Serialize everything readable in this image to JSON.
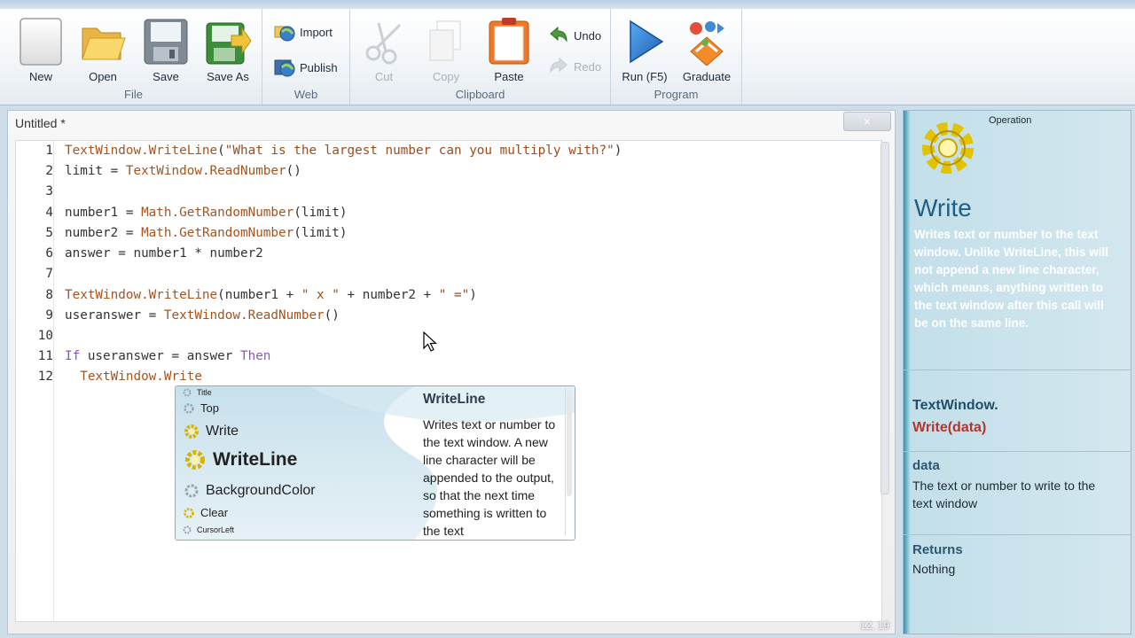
{
  "ribbon": {
    "file": {
      "label": "File",
      "new": "New",
      "open": "Open",
      "save": "Save",
      "save_as": "Save As"
    },
    "web": {
      "label": "Web",
      "import": "Import",
      "publish": "Publish"
    },
    "clipboard": {
      "label": "Clipboard",
      "cut": "Cut",
      "copy": "Copy",
      "paste": "Paste",
      "undo": "Undo",
      "redo": "Redo"
    },
    "program": {
      "label": "Program",
      "run": "Run (F5)",
      "graduate": "Graduate"
    }
  },
  "editor": {
    "doc_title": "Untitled *",
    "close_glyph": "×",
    "cursor_pos": "12, 19",
    "lines": [
      {
        "n": "1",
        "text": "TextWindow.WriteLine(\"What is the largest number can you multiply with?\")"
      },
      {
        "n": "2",
        "text": "limit = TextWindow.ReadNumber()"
      },
      {
        "n": "3",
        "text": ""
      },
      {
        "n": "4",
        "text": "number1 = Math.GetRandomNumber(limit)"
      },
      {
        "n": "5",
        "text": "number2 = Math.GetRandomNumber(limit)"
      },
      {
        "n": "6",
        "text": "answer = number1 * number2"
      },
      {
        "n": "7",
        "text": ""
      },
      {
        "n": "8",
        "text": "TextWindow.WriteLine(number1 + \" x \" + number2 + \" =\")"
      },
      {
        "n": "9",
        "text": "useranswer = TextWindow.ReadNumber()"
      },
      {
        "n": "10",
        "text": ""
      },
      {
        "n": "11",
        "text": "If useranswer = answer Then"
      },
      {
        "n": "12",
        "text": "  TextWindow.Write"
      }
    ]
  },
  "intellisense": {
    "items": [
      "Title",
      "Top",
      "Write",
      "WriteLine",
      "BackgroundColor",
      "Clear",
      "CursorLeft"
    ],
    "selected": "WriteLine",
    "detail_title": "WriteLine",
    "detail_text": "Writes text or number to the text window.  A new line character will be appended to the output, so that the next time something is written to the text"
  },
  "help": {
    "operation_label": "Operation",
    "title": "Write",
    "description": "Writes text or number to the text window.  Unlike WriteLine, this will not append a new line character, which means, anything written to the text window after this call will be on the same line.",
    "class_name": "TextWindow.",
    "signature": "Write(data)",
    "param_name": "data",
    "param_desc": "The text or number to write to the text window",
    "returns_label": "Returns",
    "returns_value": "Nothing"
  },
  "colors": {
    "keyword": "#8c56c4",
    "object": "#a5541f",
    "string": "#9e4b1c",
    "help_title": "#1f5f86",
    "signature": "#b3352d"
  },
  "icons": [
    "new-icon",
    "open-folder-icon",
    "save-icon",
    "save-as-icon",
    "import-icon",
    "publish-icon",
    "cut-icon",
    "copy-icon",
    "paste-icon",
    "undo-icon",
    "redo-icon",
    "run-icon",
    "graduate-icon",
    "gear-icon",
    "mouse-cursor-icon"
  ]
}
